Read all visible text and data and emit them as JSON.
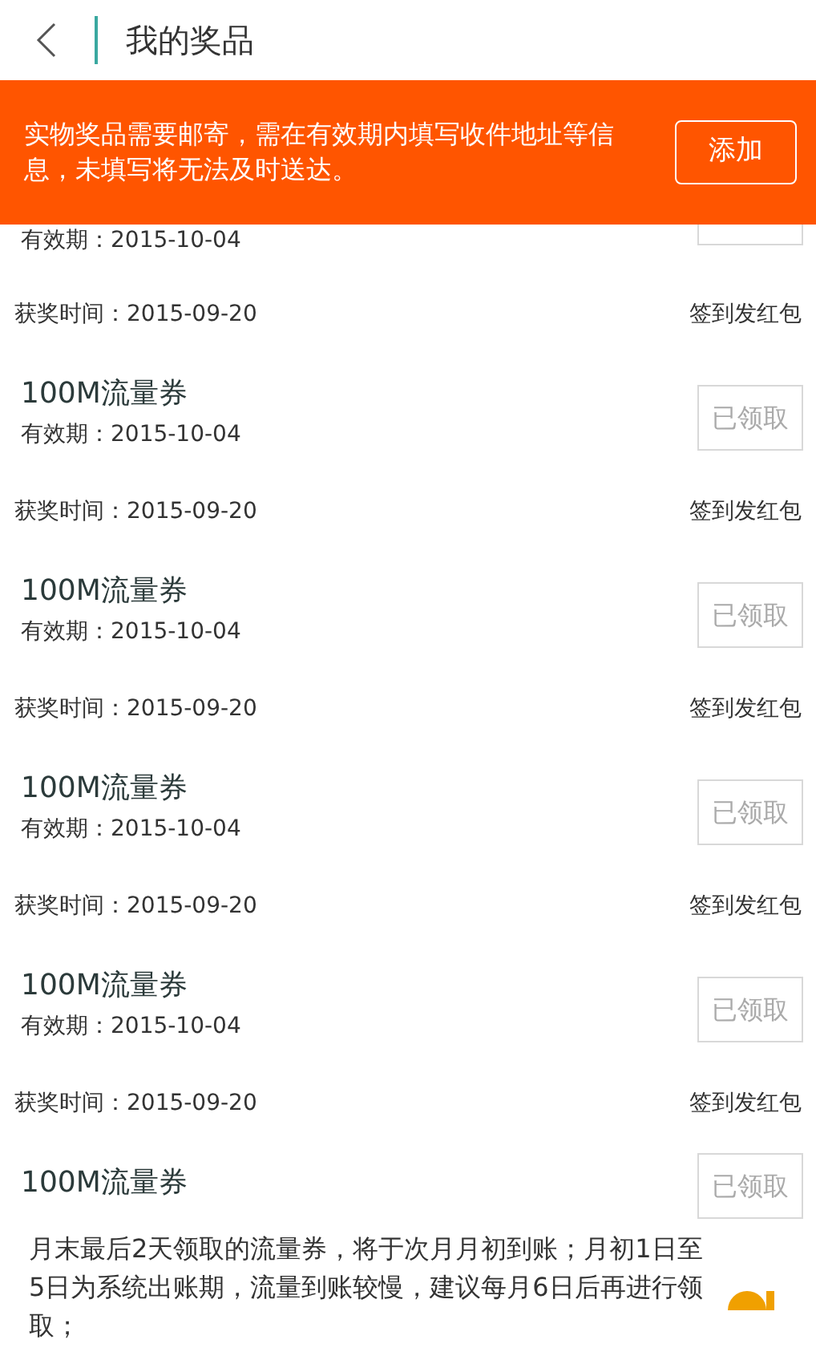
{
  "header": {
    "title": "我的奖品"
  },
  "notice": {
    "text": "实物奖品需要邮寄，需在有效期内填写收件地址等信息，未填写将无法及时送达。",
    "button": "添加"
  },
  "prizes": [
    {
      "kind": "partial",
      "validity": "有效期：2015-10-04",
      "award_time": "获奖时间：2015-09-20",
      "source": "签到发红包"
    },
    {
      "kind": "full",
      "title": "100M流量券",
      "validity": "有效期：2015-10-04",
      "button": "已领取",
      "award_time": "获奖时间：2015-09-20",
      "source": "签到发红包"
    },
    {
      "kind": "full",
      "title": "100M流量券",
      "validity": "有效期：2015-10-04",
      "button": "已领取",
      "award_time": "获奖时间：2015-09-20",
      "source": "签到发红包"
    },
    {
      "kind": "full",
      "title": "100M流量券",
      "validity": "有效期：2015-10-04",
      "button": "已领取",
      "award_time": "获奖时间：2015-09-20",
      "source": "签到发红包"
    },
    {
      "kind": "full",
      "title": "100M流量券",
      "validity": "有效期：2015-10-04",
      "button": "已领取",
      "award_time": "获奖时间：2015-09-20",
      "source": "签到发红包"
    },
    {
      "kind": "cut",
      "title": "100M流量券",
      "button": "已领取"
    }
  ],
  "footnote": "月末最后2天领取的流量券，将于次月月初到账；月初1日至5日为系统出账期，流量到账较慢，建议每月6日后再进行领取；"
}
